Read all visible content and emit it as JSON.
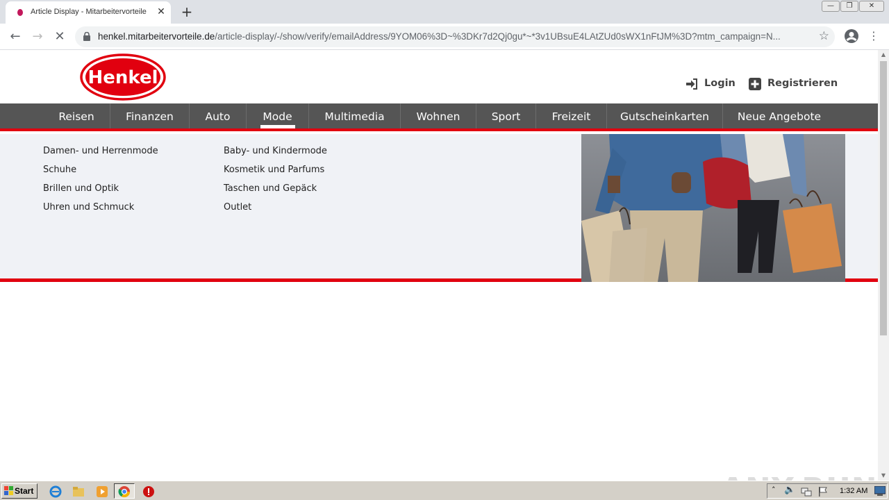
{
  "browser": {
    "tab_title": "Article Display - Mitarbeitervorteile",
    "url_host": "henkel.mitarbeitervorteile.de",
    "url_path": "/article-display/-/show/verify/emailAddress/9YOM06%3D~%3DKr7d2Qj0gu*~*3v1UBsuE4LAtZUd0sWX1nFtJM%3D?mtm_campaign=N...",
    "window_controls": [
      "minimize-icon",
      "restore-icon",
      "close-icon"
    ]
  },
  "header": {
    "logo_text": "Henkel",
    "login_label": "Login",
    "register_label": "Registrieren"
  },
  "nav": {
    "items": [
      "Reisen",
      "Finanzen",
      "Auto",
      "Mode",
      "Multimedia",
      "Wohnen",
      "Sport",
      "Freizeit",
      "Gutscheinkarten",
      "Neue Angebote"
    ],
    "active": "Mode"
  },
  "dropdown": {
    "col1": [
      "Damen- und Herrenmode",
      "Schuhe",
      "Brillen und Optik",
      "Uhren und Schmuck"
    ],
    "col2": [
      "Baby- und Kindermode",
      "Kosmetik und Parfums",
      "Taschen und Gepäck",
      "Outlet"
    ]
  },
  "watermark": "ANY.RUN",
  "taskbar": {
    "start_label": "Start",
    "clock": "1:32 AM"
  },
  "colors": {
    "brand_red": "#e1000f",
    "nav_bg": "#555555",
    "dropdown_bg": "#f0f2f6"
  }
}
